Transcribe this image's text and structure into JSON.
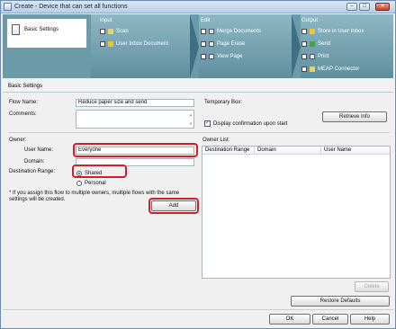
{
  "window": {
    "title": "Create - Device that can set all functions",
    "minimize": "–",
    "maximize": "□",
    "close": "✕"
  },
  "banner": {
    "basic_tab_label": "Basic Settings",
    "input": {
      "title": "Input",
      "items": [
        "Scan",
        "User Inbox Document"
      ]
    },
    "edit": {
      "title": "Edit",
      "items": [
        "Merge Documents",
        "Page Erase",
        "View Page"
      ]
    },
    "output": {
      "title": "Output",
      "items": [
        "Store in User Inbox",
        "Send",
        "Print",
        "MEAP Connector"
      ]
    }
  },
  "section_label": "Basic Settings",
  "form": {
    "flow_name_label": "Flow Name:",
    "flow_name_value": "Reduce paper size and send",
    "comments_label": "Comments:",
    "temporary_box_label": "Temporary Box:",
    "display_confirmation_label": "Display confirmation upon start",
    "retrieve_info": "Retrieve Info",
    "owner_label": "Owner:",
    "user_name_label": "User Name:",
    "user_name_value": "Everyone",
    "domain_label": "Domain:",
    "destination_range_label": "Destination Range:",
    "shared_label": "Shared",
    "personal_label": "Personal",
    "note": "* If you assign this flow to multiple owners, multiple flows with the same settings will be created.",
    "add": "Add",
    "owner_list_label": "Owner List:",
    "columns": [
      "Destination Range",
      "Domain",
      "User Name"
    ],
    "delete": "Delete"
  },
  "footer": {
    "restore_defaults": "Restore Defaults",
    "ok": "OK",
    "cancel": "Cancel",
    "help": "Help"
  },
  "colors": {
    "highlight": "#d21d2b",
    "banner": "#6b9aa9"
  }
}
